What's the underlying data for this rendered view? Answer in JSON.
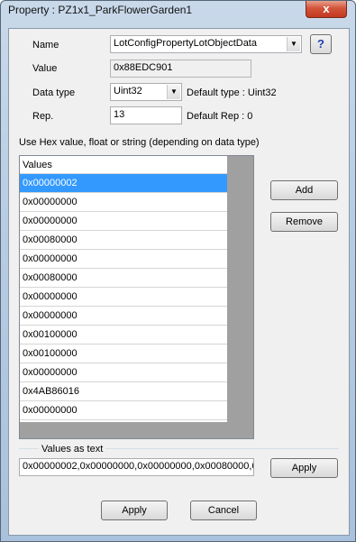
{
  "window": {
    "title": "Property : PZ1x1_ParkFlowerGarden1",
    "close_glyph": "x"
  },
  "form": {
    "name_label": "Name",
    "name_value": "LotConfigPropertyLotObjectData",
    "help_label": "?",
    "value_label": "Value",
    "value_value": "0x88EDC901",
    "datatype_label": "Data type",
    "datatype_value": "Uint32",
    "default_type_text": "Default type :  Uint32",
    "rep_label": "Rep.",
    "rep_value": "13",
    "default_rep_text": "Default Rep :  0",
    "hint": "Use Hex value, float or string (depending on data type)"
  },
  "values_list": {
    "header": "Values",
    "rows": [
      "0x00000002",
      "0x00000000",
      "0x00000000",
      "0x00080000",
      "0x00000000",
      "0x00080000",
      "0x00000000",
      "0x00000000",
      "0x00100000",
      "0x00100000",
      "0x00000000",
      "0x4AB86016",
      "0x00000000"
    ],
    "selected_index": 0
  },
  "side_buttons": {
    "add": "Add",
    "remove": "Remove"
  },
  "text_group": {
    "title": "Values as text",
    "value": "0x00000002,0x00000000,0x00000000,0x00080000,0",
    "apply": "Apply"
  },
  "footer": {
    "apply": "Apply",
    "cancel": "Cancel"
  },
  "colors": {
    "selection": "#3399ff",
    "close_button": "#c94a32",
    "help_text": "#1a3fb0"
  }
}
